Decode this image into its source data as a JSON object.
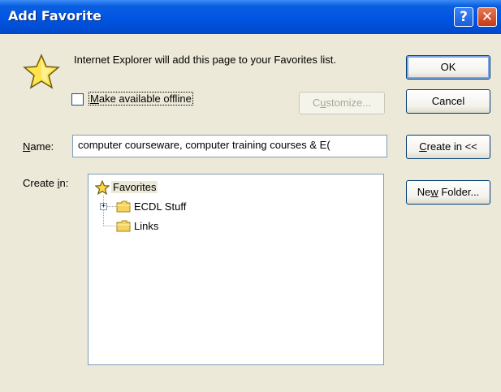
{
  "window": {
    "title": "Add Favorite",
    "help_glyph": "?",
    "close_glyph": "✕"
  },
  "message": "Internet Explorer will add this page to your Favorites list.",
  "offline": {
    "label_underlined": "M",
    "label_rest": "ake available offline",
    "checked": false
  },
  "buttons": {
    "ok": "OK",
    "cancel": "Cancel",
    "customize_underlined": "u",
    "customize_pre": "C",
    "customize_post": "stomize...",
    "create_in_underlined": "C",
    "create_in_rest": "reate in <<",
    "new_folder_pre": "Ne",
    "new_folder_underlined": "w",
    "new_folder_post": " Folder..."
  },
  "name_field": {
    "label_underlined": "N",
    "label_rest": "ame:",
    "value": "computer courseware, computer training courses & E("
  },
  "create_in": {
    "label_pre": "Create ",
    "label_underlined": "i",
    "label_post": "n:"
  },
  "tree": {
    "root": "Favorites",
    "items": [
      {
        "label": "ECDL Stuff",
        "expander": "+"
      },
      {
        "label": "Links"
      }
    ]
  },
  "icons": {
    "star": "star-icon",
    "folder": "folder-icon"
  },
  "colors": {
    "titlebar": "#0054e3",
    "dialog_bg": "#ece9d8",
    "close_btn": "#c5391a",
    "folder": "#f4d35e"
  }
}
